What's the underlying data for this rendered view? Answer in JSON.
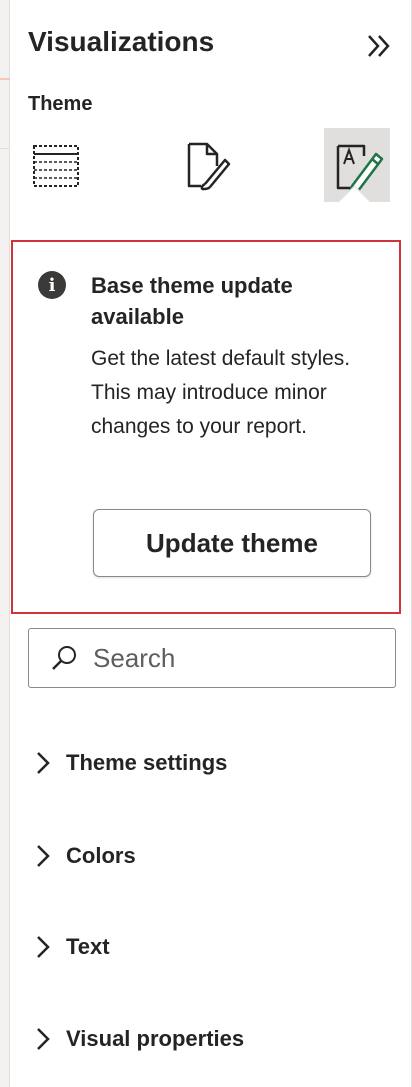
{
  "header": {
    "title": "Visualizations",
    "subtitle": "Theme"
  },
  "tabs": [
    {
      "icon": "table-outline-icon",
      "active": false
    },
    {
      "icon": "format-page-brush-icon",
      "active": false
    },
    {
      "icon": "theme-pencil-icon",
      "active": true
    }
  ],
  "notice": {
    "icon": "info-icon",
    "heading": "Base theme update available",
    "body": "Get the latest default styles. This may introduce minor changes to your report.",
    "button_label": "Update theme",
    "border_color": "#d13438"
  },
  "search": {
    "placeholder": "Search",
    "value": ""
  },
  "sections": [
    {
      "label": "Theme settings"
    },
    {
      "label": "Colors"
    },
    {
      "label": "Text"
    },
    {
      "label": "Visual properties"
    }
  ],
  "colors": {
    "accent": "#217346",
    "text": "#252423"
  }
}
